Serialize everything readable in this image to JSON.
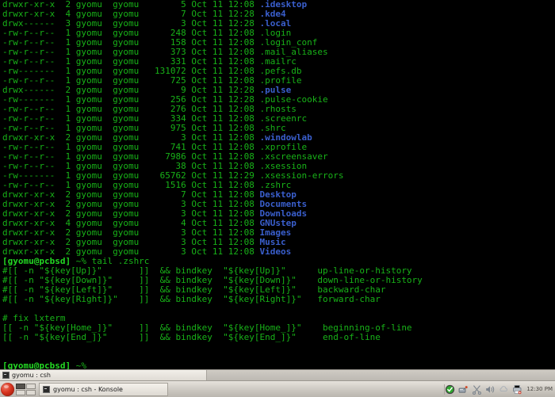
{
  "window": {
    "app": "Konsole",
    "title": "gyomu : csh — Konsole"
  },
  "terminal": {
    "shell_prompt": "[gyomu@pcbsd]",
    "prompt_suffix": "~%",
    "command": "tail .zshrc",
    "user": "gyomu",
    "group": "gyomu",
    "host": "pcbsd",
    "colors": {
      "background": "#000000",
      "foreground": "#18b218",
      "bold_green": "#23d923",
      "directory_blue": "#3a5fcd"
    },
    "listing": [
      {
        "perms": "drwxr-xr-x",
        "links": "2",
        "owner": "gyomu",
        "group": "gyomu",
        "size": "5",
        "month": "Oct",
        "day": "11",
        "time": "12:08",
        "name": ".idesktop",
        "type": "dir"
      },
      {
        "perms": "drwxr-xr-x",
        "links": "4",
        "owner": "gyomu",
        "group": "gyomu",
        "size": "7",
        "month": "Oct",
        "day": "11",
        "time": "12:28",
        "name": ".kde4",
        "type": "dir"
      },
      {
        "perms": "drwx------",
        "links": "3",
        "owner": "gyomu",
        "group": "gyomu",
        "size": "3",
        "month": "Oct",
        "day": "11",
        "time": "12:28",
        "name": ".local",
        "type": "dir"
      },
      {
        "perms": "-rw-r--r--",
        "links": "1",
        "owner": "gyomu",
        "group": "gyomu",
        "size": "248",
        "month": "Oct",
        "day": "11",
        "time": "12:08",
        "name": ".login",
        "type": "file"
      },
      {
        "perms": "-rw-r--r--",
        "links": "1",
        "owner": "gyomu",
        "group": "gyomu",
        "size": "158",
        "month": "Oct",
        "day": "11",
        "time": "12:08",
        "name": ".login_conf",
        "type": "file"
      },
      {
        "perms": "-rw-r--r--",
        "links": "1",
        "owner": "gyomu",
        "group": "gyomu",
        "size": "373",
        "month": "Oct",
        "day": "11",
        "time": "12:08",
        "name": ".mail_aliases",
        "type": "file"
      },
      {
        "perms": "-rw-r--r--",
        "links": "1",
        "owner": "gyomu",
        "group": "gyomu",
        "size": "331",
        "month": "Oct",
        "day": "11",
        "time": "12:08",
        "name": ".mailrc",
        "type": "file"
      },
      {
        "perms": "-rw-------",
        "links": "1",
        "owner": "gyomu",
        "group": "gyomu",
        "size": "131072",
        "month": "Oct",
        "day": "11",
        "time": "12:08",
        "name": ".pefs.db",
        "type": "file"
      },
      {
        "perms": "-rw-r--r--",
        "links": "1",
        "owner": "gyomu",
        "group": "gyomu",
        "size": "725",
        "month": "Oct",
        "day": "11",
        "time": "12:08",
        "name": ".profile",
        "type": "file"
      },
      {
        "perms": "drwx------",
        "links": "2",
        "owner": "gyomu",
        "group": "gyomu",
        "size": "9",
        "month": "Oct",
        "day": "11",
        "time": "12:28",
        "name": ".pulse",
        "type": "dir"
      },
      {
        "perms": "-rw-------",
        "links": "1",
        "owner": "gyomu",
        "group": "gyomu",
        "size": "256",
        "month": "Oct",
        "day": "11",
        "time": "12:28",
        "name": ".pulse-cookie",
        "type": "file"
      },
      {
        "perms": "-rw-r--r--",
        "links": "1",
        "owner": "gyomu",
        "group": "gyomu",
        "size": "276",
        "month": "Oct",
        "day": "11",
        "time": "12:08",
        "name": ".rhosts",
        "type": "file"
      },
      {
        "perms": "-rw-r--r--",
        "links": "1",
        "owner": "gyomu",
        "group": "gyomu",
        "size": "334",
        "month": "Oct",
        "day": "11",
        "time": "12:08",
        "name": ".screenrc",
        "type": "file"
      },
      {
        "perms": "-rw-r--r--",
        "links": "1",
        "owner": "gyomu",
        "group": "gyomu",
        "size": "975",
        "month": "Oct",
        "day": "11",
        "time": "12:08",
        "name": ".shrc",
        "type": "file"
      },
      {
        "perms": "drwxr-xr-x",
        "links": "2",
        "owner": "gyomu",
        "group": "gyomu",
        "size": "3",
        "month": "Oct",
        "day": "11",
        "time": "12:08",
        "name": ".windowlab",
        "type": "dir"
      },
      {
        "perms": "-rw-r--r--",
        "links": "1",
        "owner": "gyomu",
        "group": "gyomu",
        "size": "741",
        "month": "Oct",
        "day": "11",
        "time": "12:08",
        "name": ".xprofile",
        "type": "file"
      },
      {
        "perms": "-rw-r--r--",
        "links": "1",
        "owner": "gyomu",
        "group": "gyomu",
        "size": "7986",
        "month": "Oct",
        "day": "11",
        "time": "12:08",
        "name": ".xscreensaver",
        "type": "file"
      },
      {
        "perms": "-rw-r--r--",
        "links": "1",
        "owner": "gyomu",
        "group": "gyomu",
        "size": "38",
        "month": "Oct",
        "day": "11",
        "time": "12:08",
        "name": ".xsession",
        "type": "file"
      },
      {
        "perms": "-rw-------",
        "links": "1",
        "owner": "gyomu",
        "group": "gyomu",
        "size": "65762",
        "month": "Oct",
        "day": "11",
        "time": "12:29",
        "name": ".xsession-errors",
        "type": "file"
      },
      {
        "perms": "-rw-r--r--",
        "links": "1",
        "owner": "gyomu",
        "group": "gyomu",
        "size": "1516",
        "month": "Oct",
        "day": "11",
        "time": "12:08",
        "name": ".zshrc",
        "type": "file"
      },
      {
        "perms": "drwxr-xr-x",
        "links": "2",
        "owner": "gyomu",
        "group": "gyomu",
        "size": "7",
        "month": "Oct",
        "day": "11",
        "time": "12:08",
        "name": "Desktop",
        "type": "dir"
      },
      {
        "perms": "drwxr-xr-x",
        "links": "2",
        "owner": "gyomu",
        "group": "gyomu",
        "size": "3",
        "month": "Oct",
        "day": "11",
        "time": "12:08",
        "name": "Documents",
        "type": "dir"
      },
      {
        "perms": "drwxr-xr-x",
        "links": "2",
        "owner": "gyomu",
        "group": "gyomu",
        "size": "3",
        "month": "Oct",
        "day": "11",
        "time": "12:08",
        "name": "Downloads",
        "type": "dir"
      },
      {
        "perms": "drwxr-xr-x",
        "links": "4",
        "owner": "gyomu",
        "group": "gyomu",
        "size": "4",
        "month": "Oct",
        "day": "11",
        "time": "12:08",
        "name": "GNUstep",
        "type": "dir"
      },
      {
        "perms": "drwxr-xr-x",
        "links": "2",
        "owner": "gyomu",
        "group": "gyomu",
        "size": "3",
        "month": "Oct",
        "day": "11",
        "time": "12:08",
        "name": "Images",
        "type": "dir"
      },
      {
        "perms": "drwxr-xr-x",
        "links": "2",
        "owner": "gyomu",
        "group": "gyomu",
        "size": "3",
        "month": "Oct",
        "day": "11",
        "time": "12:08",
        "name": "Music",
        "type": "dir"
      },
      {
        "perms": "drwxr-xr-x",
        "links": "2",
        "owner": "gyomu",
        "group": "gyomu",
        "size": "3",
        "month": "Oct",
        "day": "11",
        "time": "12:08",
        "name": "Videos",
        "type": "dir"
      }
    ],
    "tail_output": [
      "#[[ -n \"${key[Up]}\"       ]]  && bindkey  \"${key[Up]}\"      up-line-or-history",
      "#[[ -n \"${key[Down]}\"     ]]  && bindkey  \"${key[Down]}\"    down-line-or-history",
      "#[[ -n \"${key[Left]}\"     ]]  && bindkey  \"${key[Left]}\"    backward-char",
      "#[[ -n \"${key[Right]}\"    ]]  && bindkey  \"${key[Right]}\"   forward-char",
      "",
      "# fix lxterm",
      "[[ -n \"${key[Home_]}\"     ]]  && bindkey  \"${key[Home_]}\"    beginning-of-line",
      "[[ -n \"${key[End_]}\"      ]]  && bindkey  \"${key[End_]}\"     end-of-line"
    ]
  },
  "tabbar": {
    "tabs": [
      {
        "label": "gyomu : csh",
        "active": true
      }
    ]
  },
  "taskbar": {
    "start_label": "start-menu",
    "pager": {
      "desktops": 4,
      "active": 1
    },
    "windows": [
      {
        "label": "gyomu : csh - Konsole",
        "active": true
      }
    ],
    "tray": [
      {
        "icon": "check-shield-icon",
        "label": "updates-ok"
      },
      {
        "icon": "network-icon",
        "label": "network"
      },
      {
        "icon": "scissors-icon",
        "label": "klipper"
      },
      {
        "icon": "speaker-icon",
        "label": "volume"
      },
      {
        "icon": "cloud-icon",
        "label": "weather"
      },
      {
        "icon": "printer-icon",
        "label": "printer"
      }
    ],
    "clock": "12:30 PM"
  }
}
